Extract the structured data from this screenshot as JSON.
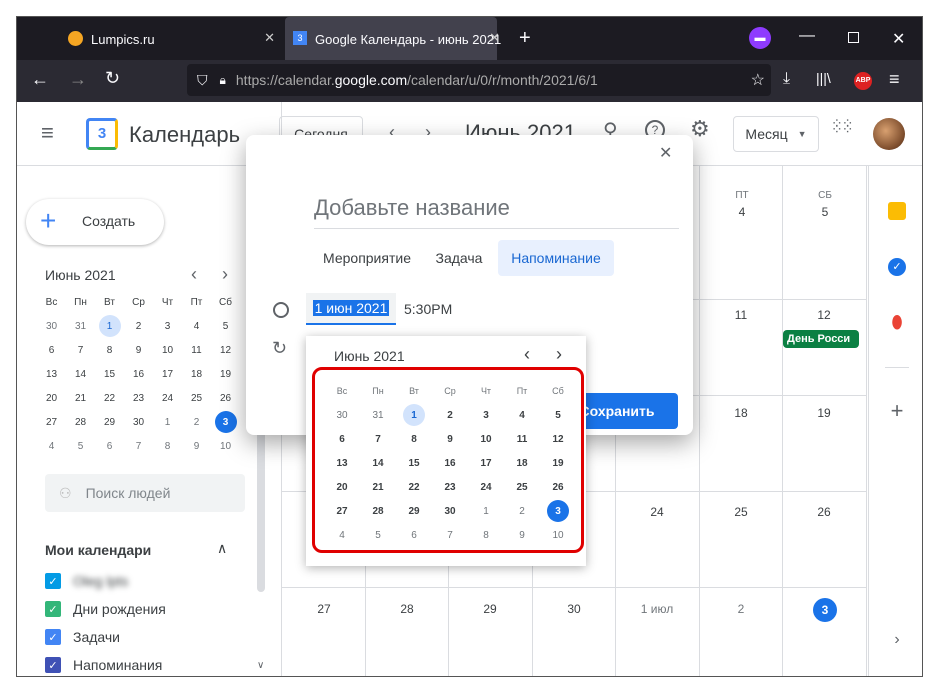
{
  "browser": {
    "tabs": [
      {
        "label": "Lumpics.ru"
      },
      {
        "label": "Google Календарь - июнь 2021"
      }
    ],
    "url_prefix": "https://calendar.",
    "url_domain": "google.com",
    "url_rest": "/calendar/u/0/r/month/2021/6/1",
    "abp": "ABP"
  },
  "header": {
    "app_name": "Календарь",
    "logo_day": "3",
    "today_btn": "Сегодня",
    "month_title": "Июнь 2021",
    "view_select": "Месяц"
  },
  "sidebar": {
    "create_label": "Создать",
    "mini_title": "Июнь 2021",
    "weekdays": [
      "Вс",
      "Пн",
      "Вт",
      "Ср",
      "Чт",
      "Пт",
      "Сб"
    ],
    "weeks": [
      [
        "30",
        "31",
        "1",
        "2",
        "3",
        "4",
        "5"
      ],
      [
        "6",
        "7",
        "8",
        "9",
        "10",
        "11",
        "12"
      ],
      [
        "13",
        "14",
        "15",
        "16",
        "17",
        "18",
        "19"
      ],
      [
        "20",
        "21",
        "22",
        "23",
        "24",
        "25",
        "26"
      ],
      [
        "27",
        "28",
        "29",
        "30",
        "1",
        "2",
        "3"
      ],
      [
        "4",
        "5",
        "6",
        "7",
        "8",
        "9",
        "10"
      ]
    ],
    "search_people": "Поиск людей",
    "my_calendars_title": "Мои календари",
    "calendars": [
      {
        "label": "Oleg lpts",
        "color": "#039be5"
      },
      {
        "label": "Дни рождения",
        "color": "#33b679"
      },
      {
        "label": "Задачи",
        "color": "#4285f4"
      },
      {
        "label": "Напоминания",
        "color": "#3f51b5"
      }
    ]
  },
  "main_grid": {
    "day_headers": [
      {
        "name": "ПТ",
        "num": "4"
      },
      {
        "name": "СБ",
        "num": "5"
      }
    ],
    "row2": [
      "11",
      "12"
    ],
    "event": {
      "label": "День Росси",
      "color": "#0b8043"
    },
    "row3": [
      "18",
      "19"
    ],
    "row4": [
      "24",
      "25",
      "26"
    ],
    "row5": [
      "27",
      "28",
      "29",
      "30",
      "1 июл",
      "2",
      "3"
    ]
  },
  "dialog": {
    "title_placeholder": "Добавьте название",
    "tabs": [
      "Мероприятие",
      "Задача",
      "Напоминание"
    ],
    "active_tab": 2,
    "date_value": "1 июн 2021",
    "time_value": "5:30PM",
    "save_label": "Сохранить"
  },
  "datepicker": {
    "title": "Июнь 2021",
    "weekdays": [
      "Вс",
      "Пн",
      "Вт",
      "Ср",
      "Чт",
      "Пт",
      "Сб"
    ],
    "weeks": [
      [
        "30",
        "31",
        "1",
        "2",
        "3",
        "4",
        "5"
      ],
      [
        "6",
        "7",
        "8",
        "9",
        "10",
        "11",
        "12"
      ],
      [
        "13",
        "14",
        "15",
        "16",
        "17",
        "18",
        "19"
      ],
      [
        "20",
        "21",
        "22",
        "23",
        "24",
        "25",
        "26"
      ],
      [
        "27",
        "28",
        "29",
        "30",
        "1",
        "2",
        "3"
      ],
      [
        "4",
        "5",
        "6",
        "7",
        "8",
        "9",
        "10"
      ]
    ]
  }
}
